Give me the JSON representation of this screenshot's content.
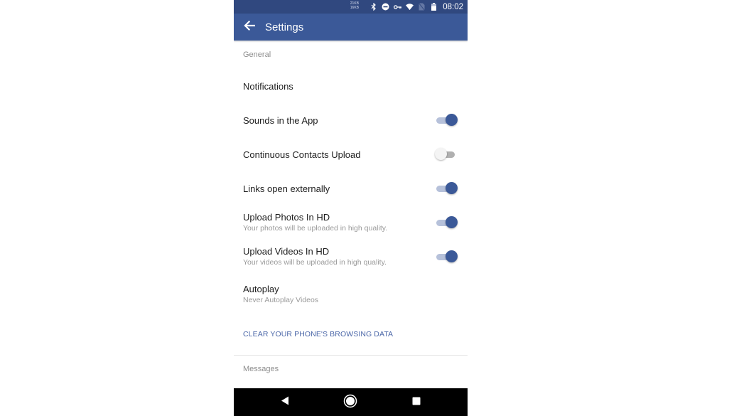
{
  "status_bar": {
    "net_speed_up": "21KB",
    "net_speed_down": "16KB",
    "icons": [
      "bluetooth-icon",
      "do-not-disturb-icon",
      "vpn-key-icon",
      "wifi-icon",
      "no-sim-icon",
      "battery-icon"
    ],
    "time": "08:02"
  },
  "app_bar": {
    "back_icon": "arrow-left-icon",
    "title": "Settings"
  },
  "sections": {
    "general": {
      "header": "General",
      "items": [
        {
          "title": "Notifications"
        },
        {
          "title": "Sounds in the App",
          "toggle": true
        },
        {
          "title": "Continuous Contacts Upload",
          "toggle": false
        },
        {
          "title": "Links open externally",
          "toggle": true
        },
        {
          "title": "Upload Photos In HD",
          "subtitle": "Your photos will be uploaded in high quality.",
          "toggle": true
        },
        {
          "title": "Upload Videos In HD",
          "subtitle": "Your videos will be uploaded in high quality.",
          "toggle": true
        },
        {
          "title": "Autoplay",
          "subtitle": "Never Autoplay Videos"
        }
      ],
      "action": "CLEAR YOUR PHONE'S BROWSING DATA"
    },
    "messages": {
      "header": "Messages"
    }
  },
  "nav_bar": {
    "back": "nav-back-icon",
    "home": "nav-home-icon",
    "recents": "nav-recents-icon"
  },
  "colors": {
    "brand": "#3b5998",
    "status_bar": "#30487f",
    "switch_on_track": "#b6c1da",
    "link": "#4b67a8"
  }
}
